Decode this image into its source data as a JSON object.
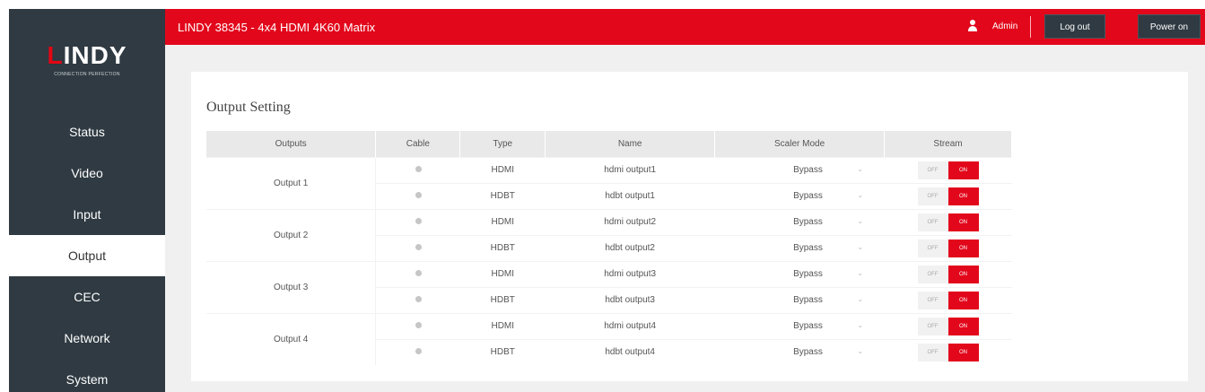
{
  "header": {
    "app_title": "LINDY 38345 - 4x4 HDMI 4K60 Matrix",
    "user_icon": "user-icon",
    "admin_label": "Admin",
    "logout_label": "Log out",
    "poweron_label": "Power on"
  },
  "logo": {
    "text_red": "L",
    "text_rest": "INDY",
    "tagline": "CONNECTION PERFECTION"
  },
  "sidebar": {
    "items": [
      {
        "label": "Status"
      },
      {
        "label": "Video"
      },
      {
        "label": "Input"
      },
      {
        "label": "Output",
        "active": true
      },
      {
        "label": "CEC"
      },
      {
        "label": "Network"
      },
      {
        "label": "System"
      }
    ]
  },
  "main": {
    "section_title": "Output Setting",
    "columns": [
      "Outputs",
      "Cable",
      "Type",
      "Name",
      "Scaler Mode",
      "Stream"
    ],
    "outputs": [
      {
        "label": "Output 1",
        "rows": [
          {
            "type": "HDMI",
            "name": "hdmi output1",
            "scaler": "Bypass",
            "off": "OFF",
            "on": "ON"
          },
          {
            "type": "HDBT",
            "name": "hdbt output1",
            "scaler": "Bypass",
            "off": "OFF",
            "on": "ON"
          }
        ]
      },
      {
        "label": "Output 2",
        "rows": [
          {
            "type": "HDMI",
            "name": "hdmi output2",
            "scaler": "Bypass",
            "off": "OFF",
            "on": "ON"
          },
          {
            "type": "HDBT",
            "name": "hdbt output2",
            "scaler": "Bypass",
            "off": "OFF",
            "on": "ON"
          }
        ]
      },
      {
        "label": "Output 3",
        "rows": [
          {
            "type": "HDMI",
            "name": "hdmi output3",
            "scaler": "Bypass",
            "off": "OFF",
            "on": "ON"
          },
          {
            "type": "HDBT",
            "name": "hdbt output3",
            "scaler": "Bypass",
            "off": "OFF",
            "on": "ON"
          }
        ]
      },
      {
        "label": "Output 4",
        "rows": [
          {
            "type": "HDMI",
            "name": "hdmi output4",
            "scaler": "Bypass",
            "off": "OFF",
            "on": "ON"
          },
          {
            "type": "HDBT",
            "name": "hdbt output4",
            "scaler": "Bypass",
            "off": "OFF",
            "on": "ON"
          }
        ]
      }
    ]
  },
  "colors": {
    "brand_red": "#e2071b",
    "sidebar_bg": "#2f3a42"
  }
}
